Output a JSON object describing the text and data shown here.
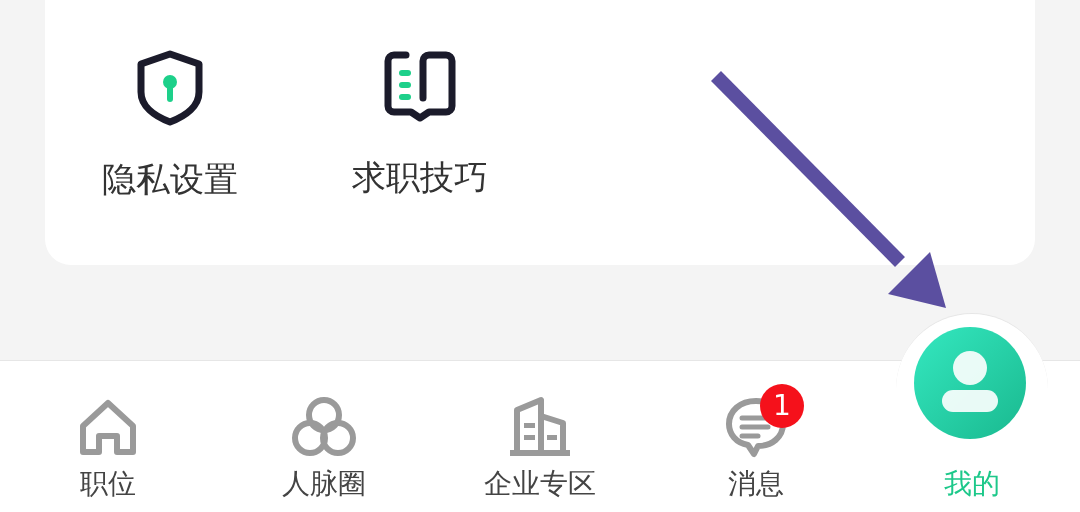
{
  "tools": [
    {
      "label": "隐私设置",
      "kind": "shield"
    },
    {
      "label": "求职技巧",
      "kind": "book"
    }
  ],
  "annotation": {
    "kind": "arrow"
  },
  "tab_bar": [
    {
      "label": "职位",
      "kind": "home",
      "selected": false
    },
    {
      "label": "人脉圈",
      "kind": "circles",
      "selected": false
    },
    {
      "label": "企业专区",
      "kind": "building",
      "selected": false
    },
    {
      "label": "消息",
      "kind": "chat",
      "selected": false,
      "badge": "1"
    },
    {
      "label": "我的",
      "kind": "profile",
      "selected": true
    }
  ]
}
